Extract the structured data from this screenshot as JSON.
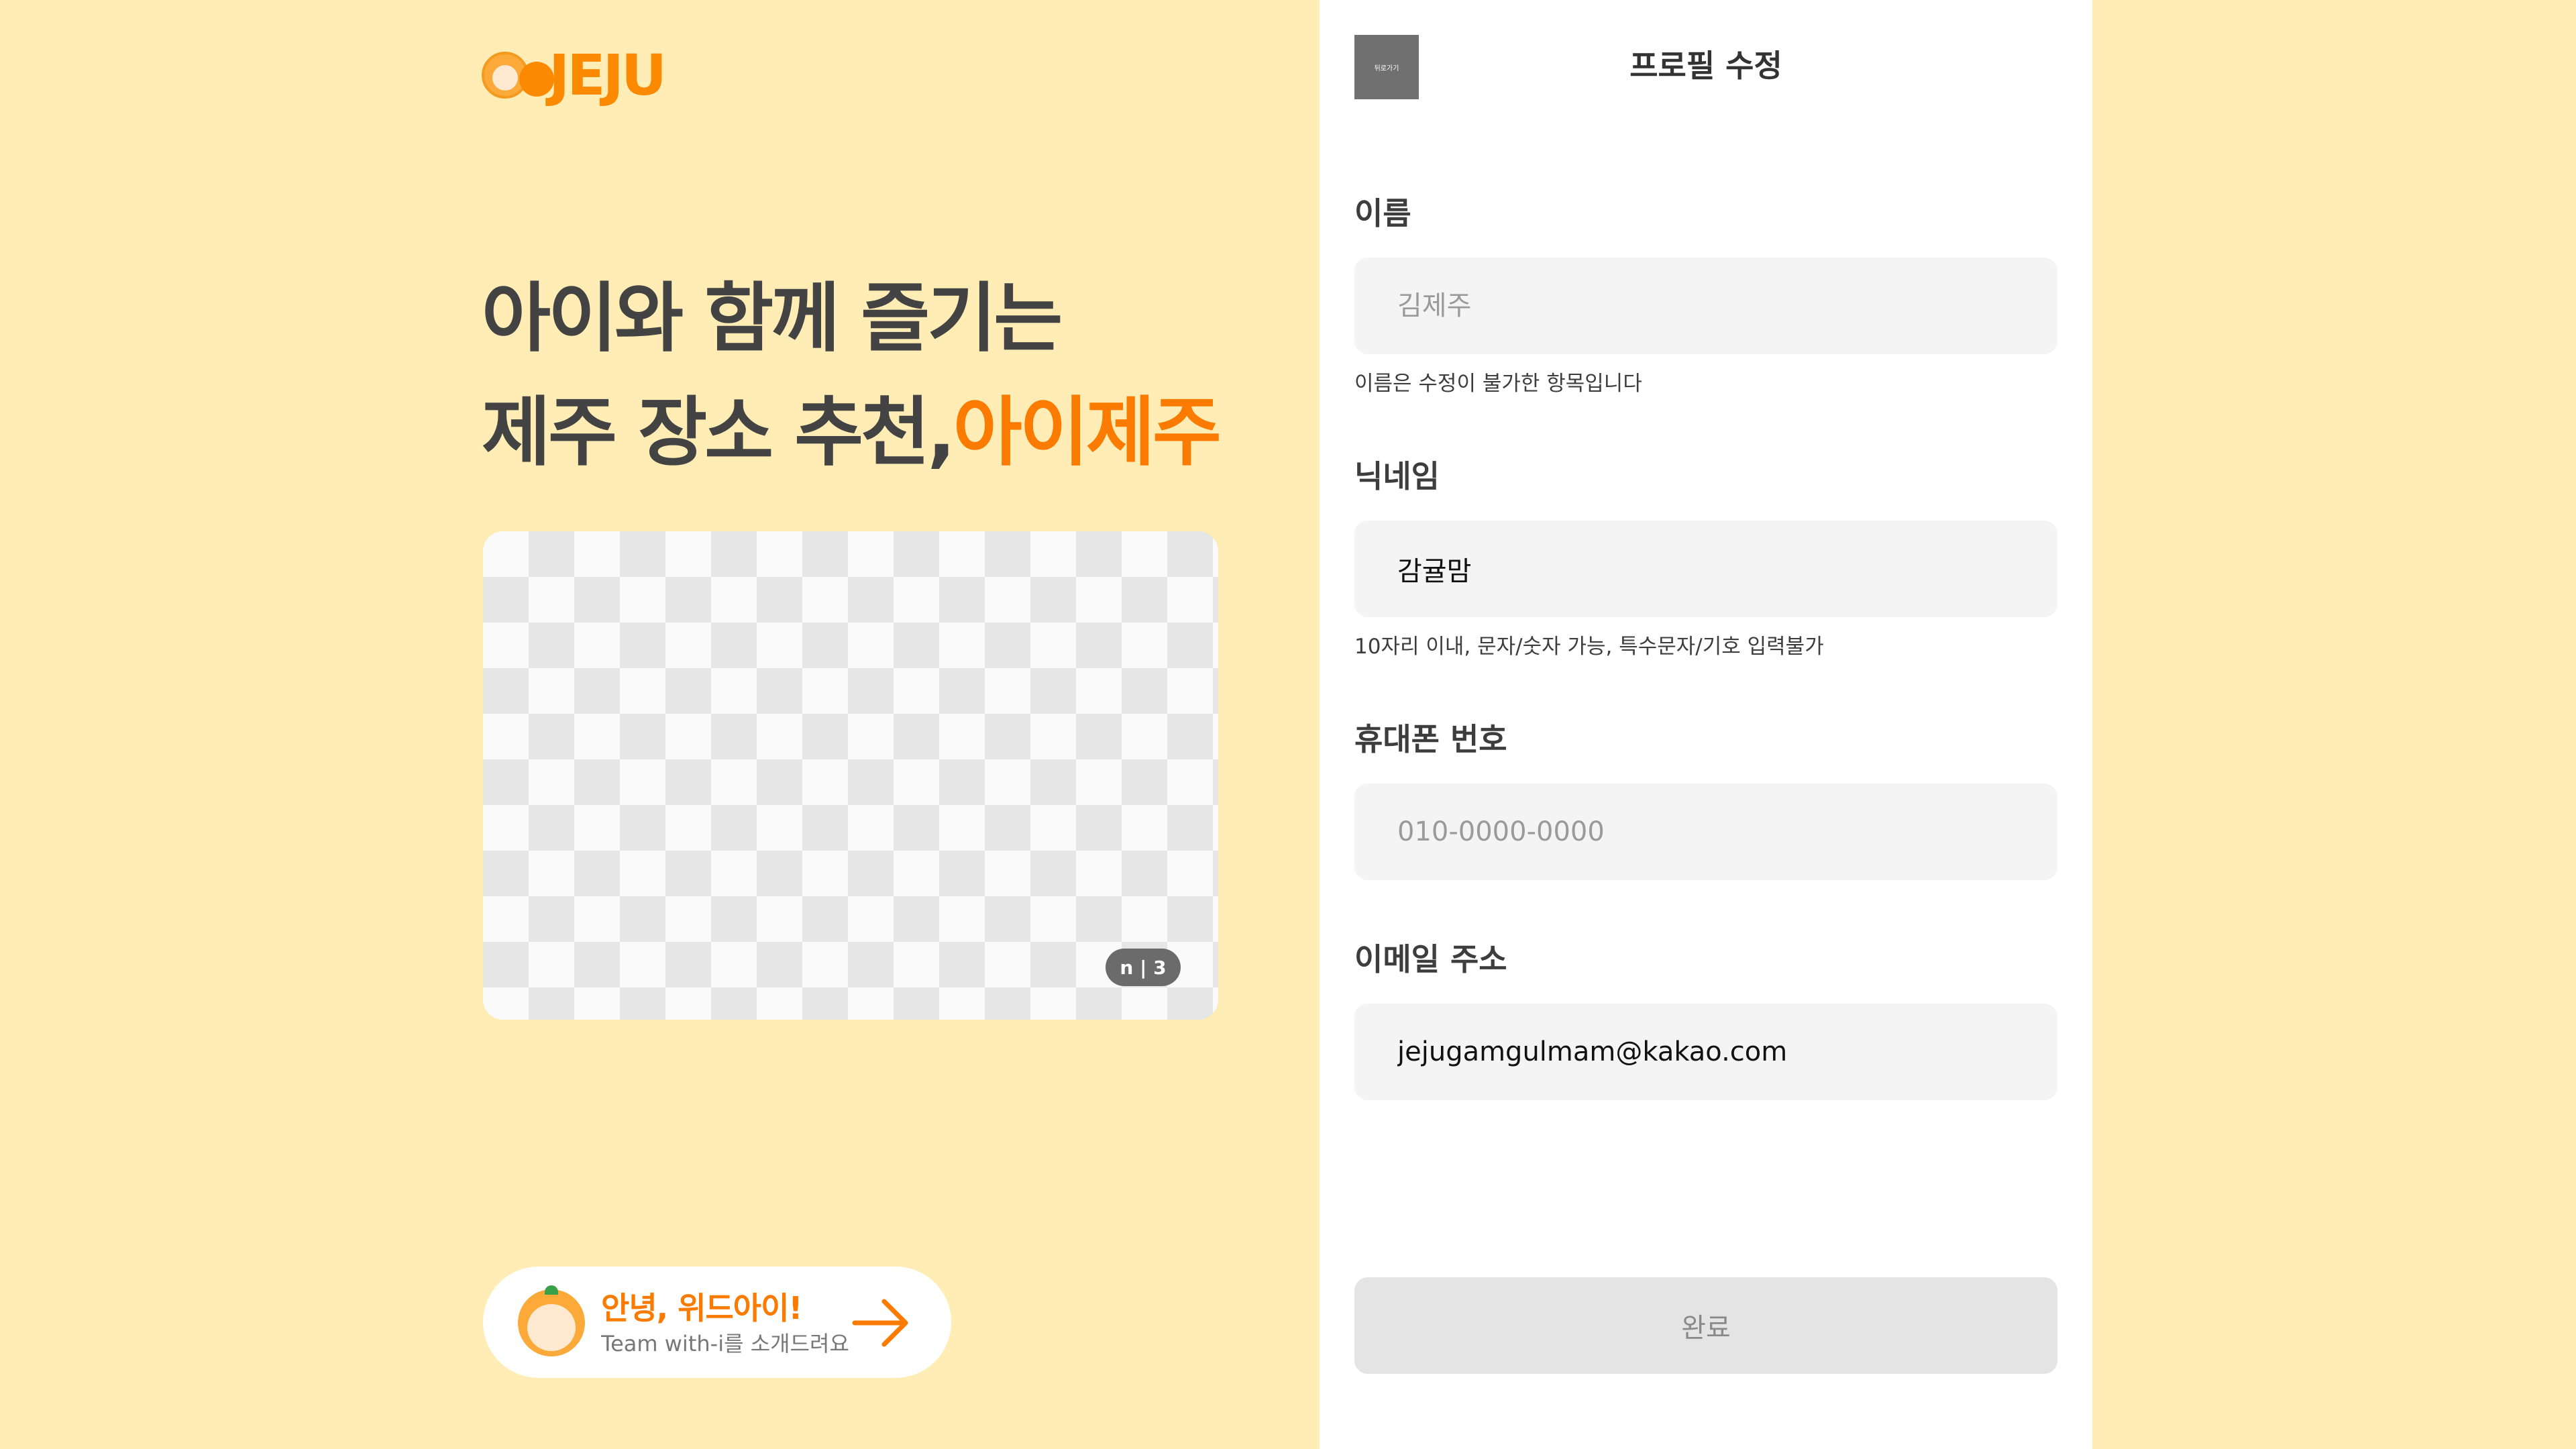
{
  "brand": {
    "logo_text": "JEJU"
  },
  "hero": {
    "line1": "아이와 함께 즐기는",
    "line2_main": "제주 장소 추천,",
    "line2_accent": "아이제주"
  },
  "carousel": {
    "pager": "n | 3"
  },
  "promo": {
    "title": "안녕, 위드아이!",
    "subtitle": "Team with-i를 소개드려요"
  },
  "panel": {
    "back_label": "뒤로가기",
    "title": "프로필 수정",
    "name": {
      "label": "이름",
      "placeholder": "김제주",
      "hint": "이름은 수정이 불가한 항목입니다"
    },
    "nickname": {
      "label": "닉네임",
      "value": "감귤맘",
      "hint": "10자리 이내, 문자/숫자 가능, 특수문자/기호 입력불가"
    },
    "phone": {
      "label": "휴대폰 번호",
      "placeholder": "010-0000-0000"
    },
    "email": {
      "label": "이메일 주소",
      "value": "jejugamgulmam@kakao.com"
    },
    "submit_label": "완료"
  },
  "colors": {
    "background": "#FFEDB5",
    "accent": "#FB7A00",
    "field_bg": "#F4F4F4",
    "submit_bg": "#E4E4E4"
  }
}
